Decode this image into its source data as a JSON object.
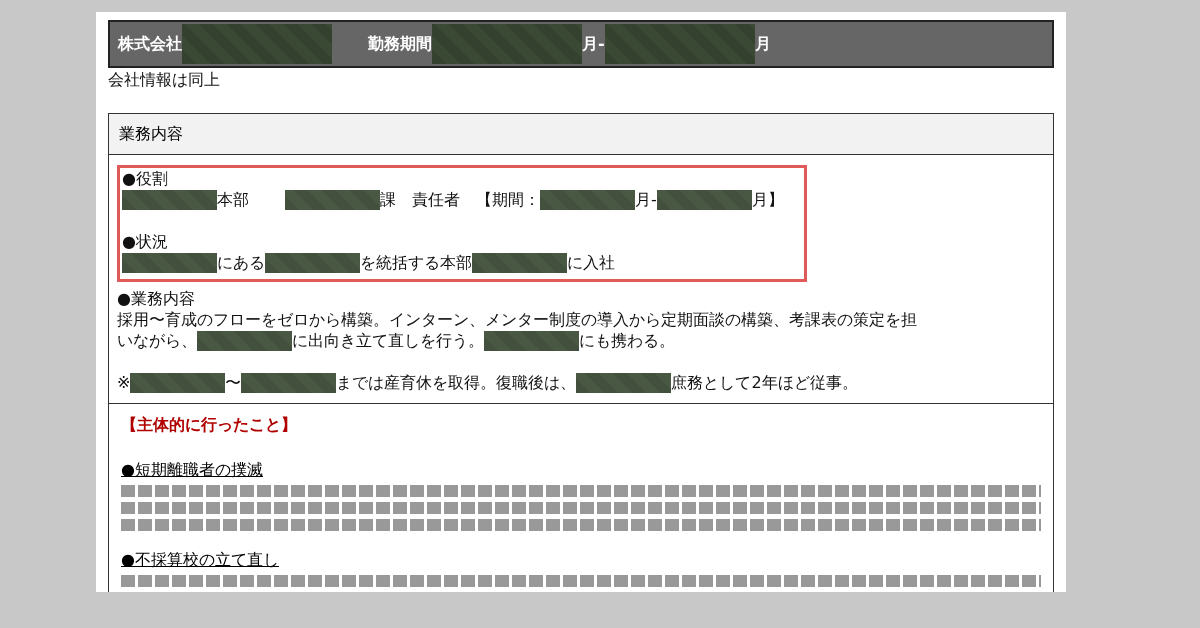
{
  "header": {
    "segments": [
      {
        "kind": "text",
        "text": "株式会社"
      },
      {
        "kind": "redacted"
      },
      {
        "kind": "gap"
      },
      {
        "kind": "text",
        "text": "勤務期間"
      },
      {
        "kind": "redacted"
      },
      {
        "kind": "text",
        "text": "月-"
      },
      {
        "kind": "redacted"
      },
      {
        "kind": "text",
        "text": "月"
      }
    ]
  },
  "company_note": "会社情報は同上",
  "section": {
    "title": "業務内容",
    "highlighted_block": [
      {
        "heading": "●役割",
        "segments": [
          {
            "kind": "redacted"
          },
          {
            "kind": "text",
            "text": "本部"
          },
          {
            "kind": "gap"
          },
          {
            "kind": "redacted"
          },
          {
            "kind": "text",
            "text": "課　責任者　【期間："
          },
          {
            "kind": "redacted"
          },
          {
            "kind": "text",
            "text": "月-"
          },
          {
            "kind": "redacted"
          },
          {
            "kind": "text",
            "text": "月】"
          }
        ]
      },
      {
        "heading": "●状況",
        "segments": [
          {
            "kind": "redacted"
          },
          {
            "kind": "text",
            "text": "にある"
          },
          {
            "kind": "redacted"
          },
          {
            "kind": "text",
            "text": "を統括する本部"
          },
          {
            "kind": "redacted"
          },
          {
            "kind": "text",
            "text": "に入社"
          }
        ]
      }
    ],
    "duties_heading": "●業務内容",
    "duties_lines": [
      {
        "segments": [
          {
            "kind": "text",
            "text": "採用〜育成のフローをゼロから構築。インターン、メンター制度の導入から定期面談の構築、考課表の策定を担"
          }
        ]
      },
      {
        "segments": [
          {
            "kind": "text",
            "text": "いながら、"
          },
          {
            "kind": "redacted"
          },
          {
            "kind": "text",
            "text": "に出向き立て直しを行う。"
          },
          {
            "kind": "redacted"
          },
          {
            "kind": "text",
            "text": "にも携わる。"
          }
        ]
      }
    ],
    "note_line": {
      "segments": [
        {
          "kind": "text",
          "text": "※"
        },
        {
          "kind": "redacted"
        },
        {
          "kind": "text",
          "text": "〜"
        },
        {
          "kind": "redacted"
        },
        {
          "kind": "text",
          "text": "までは産育休を取得。復職後は、"
        },
        {
          "kind": "redacted"
        },
        {
          "kind": "text",
          "text": "庶務として2年ほど従事。"
        }
      ]
    }
  },
  "initiatives": {
    "title": "【主体的に行ったこと】",
    "items": [
      {
        "heading": "●短期離職者の撲滅",
        "lines": [
          {
            "kind": "illegible"
          },
          {
            "kind": "illegible"
          },
          {
            "kind": "illegible"
          }
        ]
      },
      {
        "heading": "●不採算校の立て直し",
        "lines": [
          {
            "kind": "illegible"
          }
        ]
      }
    ]
  }
}
